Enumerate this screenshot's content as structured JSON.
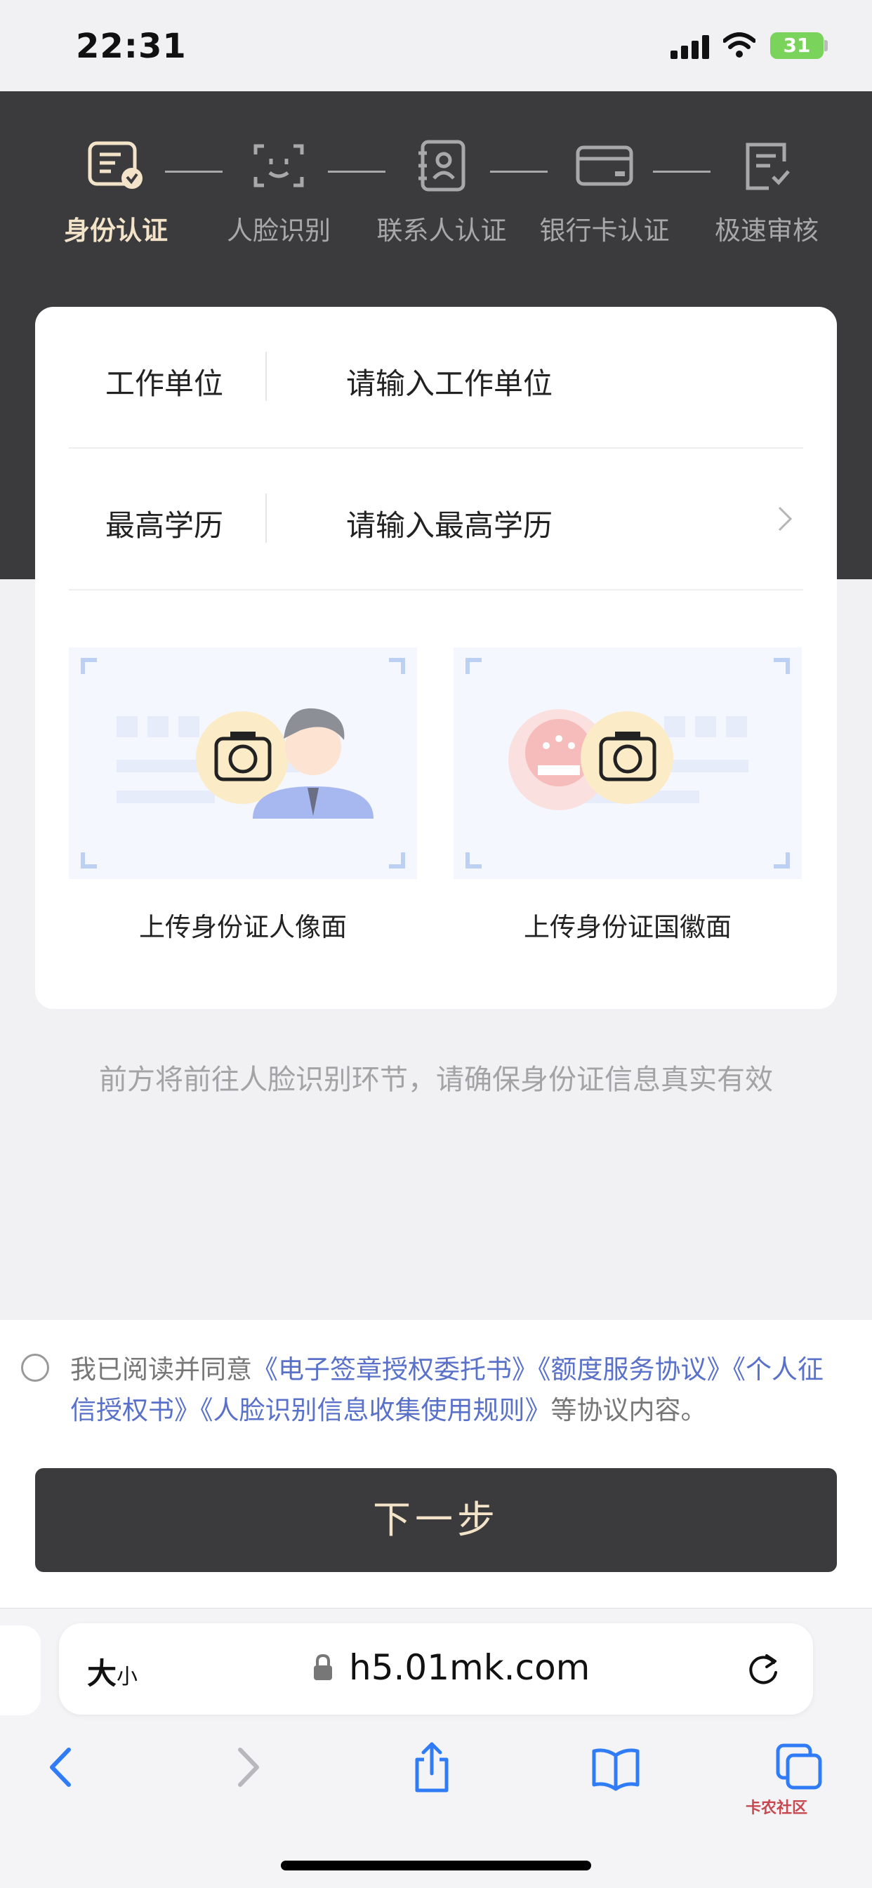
{
  "status_bar": {
    "time": "22:31",
    "battery": "31"
  },
  "steps": [
    {
      "label": "身份认证",
      "icon": "id-card-check-icon",
      "active": true
    },
    {
      "label": "人脸识别",
      "icon": "face-scan-icon",
      "active": false
    },
    {
      "label": "联系人认证",
      "icon": "contact-book-icon",
      "active": false
    },
    {
      "label": "银行卡认证",
      "icon": "bank-card-icon",
      "active": false
    },
    {
      "label": "极速审核",
      "icon": "review-check-icon",
      "active": false
    }
  ],
  "form": {
    "work_unit": {
      "label": "工作单位",
      "value": "请输入工作单位"
    },
    "education": {
      "label": "最高学历",
      "value": "请输入最高学历"
    }
  },
  "uploads": {
    "front": {
      "caption": "上传身份证人像面"
    },
    "back": {
      "caption": "上传身份证国徽面"
    }
  },
  "notice": "前方将前往人脸识别环节，请确保身份证信息真实有效",
  "agreement": {
    "prefix": "我已阅读并同意",
    "links": [
      "《电子签章授权委托书》",
      "《额度服务协议》",
      "《个人征信授权书》",
      "《人脸识别信息收集使用规则》"
    ],
    "suffix": "等协议内容。"
  },
  "next_button": "下一步",
  "browser": {
    "text_size_big": "大",
    "text_size_small": "小",
    "url": "h5.01mk.com"
  },
  "watermark": "卡农社区",
  "colors": {
    "header_bg": "#3b3b3d",
    "accent_text": "#f3e3c8",
    "link": "#5a71c9"
  }
}
